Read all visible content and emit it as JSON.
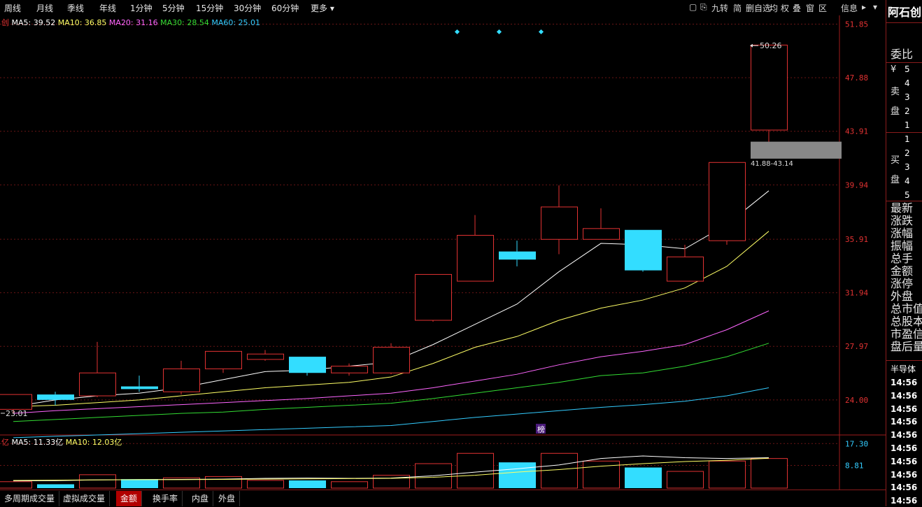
{
  "period_tabs": [
    "周线",
    "月线",
    "季线",
    "年线",
    "1分钟",
    "5分钟",
    "15分钟",
    "30分钟",
    "60分钟",
    "更多 ▾"
  ],
  "right_tools": [
    "九转",
    "简",
    "删自选",
    "均",
    "权",
    "叠",
    "窗",
    "区",
    "信息"
  ],
  "stock_name": "阿石创",
  "ma_legend": {
    "prefix": "创",
    "items": [
      {
        "label": "MA5: 39.52",
        "color": "#ffffff"
      },
      {
        "label": "MA10: 36.85",
        "color": "#ffff66"
      },
      {
        "label": "MA20: 31.16",
        "color": "#ff66ff"
      },
      {
        "label": "MA30: 28.54",
        "color": "#33dd33"
      },
      {
        "label": "MA60: 25.01",
        "color": "#33ccff"
      }
    ]
  },
  "vol_legend": {
    "prefix": "亿",
    "items": [
      {
        "label": "MA5: 11.33亿",
        "color": "#ffffff"
      },
      {
        "label": "MA10: 12.03亿",
        "color": "#ffff66"
      }
    ]
  },
  "price_axis": [
    "51.85",
    "47.88",
    "43.91",
    "39.94",
    "35.91",
    "31.94",
    "27.97",
    "24.00"
  ],
  "volume_axis": [
    "17.30",
    "8.81"
  ],
  "annotations": {
    "high": "50.26",
    "low": "23.01",
    "band": "41.88-43.14",
    "bang": "榜"
  },
  "chart_data": {
    "type": "candlestick",
    "candles": [
      {
        "o": 23.3,
        "h": 24.4,
        "l": 23.0,
        "c": 24.4,
        "up": true
      },
      {
        "o": 24.0,
        "h": 24.6,
        "l": 23.6,
        "c": 24.4,
        "up": false
      },
      {
        "o": 24.3,
        "h": 28.3,
        "l": 24.2,
        "c": 26.0,
        "up": true
      },
      {
        "o": 25.0,
        "h": 25.8,
        "l": 24.6,
        "c": 24.8,
        "up": false
      },
      {
        "o": 24.6,
        "h": 26.9,
        "l": 24.4,
        "c": 26.3,
        "up": true
      },
      {
        "o": 26.3,
        "h": 27.6,
        "l": 26.0,
        "c": 27.6,
        "up": true
      },
      {
        "o": 27.0,
        "h": 27.7,
        "l": 26.9,
        "c": 27.4,
        "up": true
      },
      {
        "o": 27.2,
        "h": 27.2,
        "l": 25.8,
        "c": 26.0,
        "up": false
      },
      {
        "o": 26.0,
        "h": 26.7,
        "l": 25.8,
        "c": 26.5,
        "up": true
      },
      {
        "o": 26.0,
        "h": 28.2,
        "l": 25.9,
        "c": 27.9,
        "up": true
      },
      {
        "o": 29.9,
        "h": 33.3,
        "l": 29.8,
        "c": 33.3,
        "up": true
      },
      {
        "o": 32.8,
        "h": 37.7,
        "l": 32.8,
        "c": 36.2,
        "up": true
      },
      {
        "o": 35.0,
        "h": 35.8,
        "l": 33.9,
        "c": 34.4,
        "up": false
      },
      {
        "o": 35.9,
        "h": 39.9,
        "l": 34.8,
        "c": 38.3,
        "up": true
      },
      {
        "o": 35.9,
        "h": 38.2,
        "l": 35.9,
        "c": 36.7,
        "up": true
      },
      {
        "o": 36.6,
        "h": 36.6,
        "l": 33.5,
        "c": 33.6,
        "up": false
      },
      {
        "o": 32.8,
        "h": 35.5,
        "l": 32.8,
        "c": 34.6,
        "up": true
      },
      {
        "o": 35.8,
        "h": 41.6,
        "l": 35.5,
        "c": 41.6,
        "up": true
      },
      {
        "o": 44.0,
        "h": 50.3,
        "l": 41.9,
        "c": 50.3,
        "up": true
      }
    ],
    "volume_up": [
      true,
      false,
      true,
      false,
      true,
      true,
      true,
      false,
      true,
      true,
      true,
      true,
      false,
      true,
      true,
      false,
      true,
      true,
      true
    ],
    "volume": [
      2.5,
      1.5,
      5.2,
      3.5,
      4.0,
      4.5,
      3.0,
      3.0,
      2.5,
      5.0,
      9.5,
      13.5,
      10.0,
      13.5,
      10.5,
      8.0,
      6.5,
      10.5,
      11.5
    ],
    "ma_lines": [
      {
        "name": "MA5",
        "color": "#ffffff",
        "values": [
          23.5,
          24.0,
          24.3,
          24.5,
          24.9,
          25.5,
          26.1,
          26.2,
          26.5,
          26.8,
          28.1,
          29.6,
          31.1,
          33.5,
          35.6,
          35.5,
          35.2,
          37.0,
          39.5
        ]
      },
      {
        "name": "MA10",
        "color": "#ffff66",
        "values": [
          23.5,
          23.6,
          23.8,
          24.0,
          24.3,
          24.6,
          24.9,
          25.1,
          25.3,
          25.7,
          26.7,
          27.9,
          28.7,
          29.9,
          30.8,
          31.4,
          32.3,
          33.9,
          36.5
        ]
      },
      {
        "name": "MA20",
        "color": "#ff66ff",
        "values": [
          23.0,
          23.2,
          23.35,
          23.5,
          23.65,
          23.8,
          23.95,
          24.1,
          24.3,
          24.5,
          24.9,
          25.4,
          25.9,
          26.6,
          27.2,
          27.6,
          28.1,
          29.2,
          30.6
        ]
      },
      {
        "name": "MA30",
        "color": "#33dd33",
        "values": [
          22.4,
          22.55,
          22.7,
          22.85,
          23.0,
          23.1,
          23.3,
          23.45,
          23.6,
          23.75,
          24.1,
          24.5,
          24.9,
          25.3,
          25.8,
          26.0,
          26.5,
          27.2,
          28.2
        ]
      },
      {
        "name": "MA60",
        "color": "#33ccff",
        "values": [
          21.2,
          21.3,
          21.4,
          21.5,
          21.6,
          21.7,
          21.8,
          21.9,
          22.0,
          22.1,
          22.4,
          22.7,
          22.95,
          23.2,
          23.45,
          23.65,
          23.9,
          24.3,
          24.9
        ]
      }
    ],
    "vol_ma": [
      {
        "name": "MA5",
        "color": "#ffffff",
        "values": [
          2.8,
          2.9,
          3.2,
          3.3,
          3.4,
          3.5,
          3.8,
          3.9,
          3.8,
          3.9,
          4.8,
          6.2,
          7.5,
          9.0,
          11.5,
          12.5,
          11.8,
          11.5,
          11.8
        ]
      },
      {
        "name": "MA10",
        "color": "#ffff66",
        "values": [
          3.0,
          3.1,
          3.2,
          3.3,
          3.3,
          3.4,
          3.5,
          3.6,
          3.7,
          3.8,
          4.2,
          5.0,
          6.2,
          7.2,
          8.5,
          9.5,
          10.3,
          10.8,
          11.6
        ]
      }
    ],
    "ylim": [
      21.4,
      52.5
    ],
    "vol_ylim": [
      0,
      19
    ]
  },
  "side_panel": {
    "weibi": "委比",
    "sell_label": [
      "¥",
      "卖",
      "盘"
    ],
    "sell_levels": [
      "5",
      "4",
      "3",
      "2",
      "1"
    ],
    "buy_label": [
      "买",
      "盘"
    ],
    "buy_levels": [
      "1",
      "2",
      "3",
      "4",
      "5"
    ],
    "fields": [
      "最新",
      "涨跌",
      "涨幅",
      "振幅",
      "总手",
      "金额",
      "涨停",
      "外盘",
      "总市值",
      "总股本",
      "市盈信",
      "盘后量"
    ],
    "sector": "半导体",
    "times": [
      "14:56",
      "14:56",
      "14:56",
      "14:56",
      "14:56",
      "14:56",
      "14:56",
      "14:56",
      "14:56",
      "14:56"
    ]
  },
  "bottom_tabs": [
    {
      "label": "多周期成交量",
      "active": false
    },
    {
      "label": "虚拟成交量",
      "active": false
    },
    {
      "label": "金额",
      "active": true
    },
    {
      "label": "换手率",
      "active": false
    },
    {
      "label": "内盘",
      "active": false
    },
    {
      "label": "外盘",
      "active": false
    }
  ]
}
